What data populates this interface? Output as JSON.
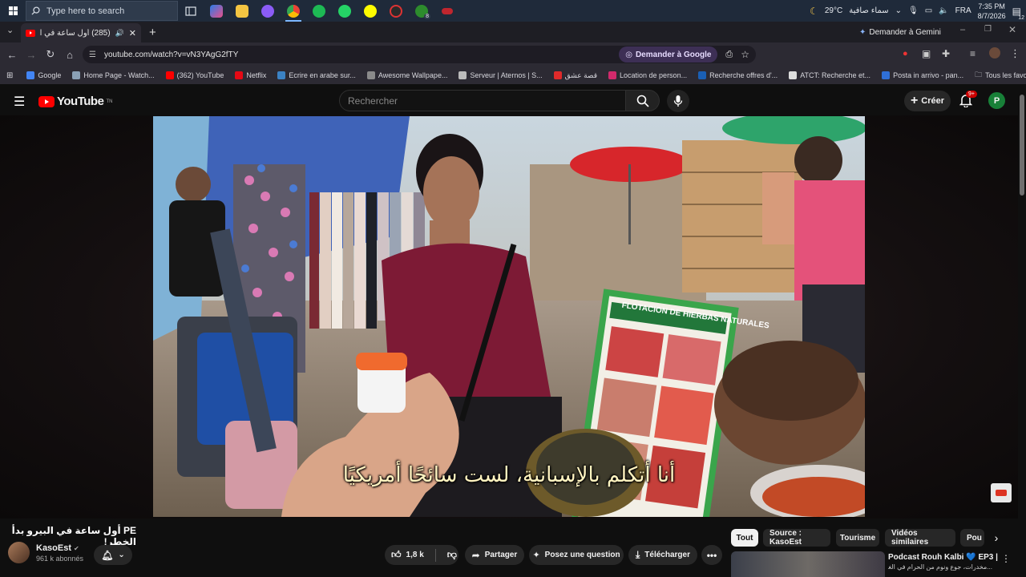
{
  "taskbar": {
    "search_placeholder": "Type here to search",
    "weather": "29°C",
    "weather_text": "سماء صافية",
    "language": "FRA",
    "time": "7:35 PM",
    "date": "8/7/2026",
    "notifications": "12",
    "xbox_badge": "8"
  },
  "browser": {
    "tab_title": "(285) أول ساعة في البيرو بدأ",
    "new_tab": "+",
    "gemini_tab_button": "Demander à Gemini",
    "url": "youtube.com/watch?v=vN3YAgG2fTY",
    "ask_google": "Demander à Google",
    "bookmarks": [
      {
        "label": "Google",
        "color": "#4285f4"
      },
      {
        "label": "Home Page - Watch...",
        "color": "#8aa0b5"
      },
      {
        "label": "(362) YouTube",
        "color": "#ff0000"
      },
      {
        "label": "Netflix",
        "color": "#e50914"
      },
      {
        "label": "Ecrire en arabe sur...",
        "color": "#3b82c4"
      },
      {
        "label": "Awesome Wallpape...",
        "color": "#8a8a8a"
      },
      {
        "label": "Serveur | Aternos | S...",
        "color": "#bbbbbb"
      },
      {
        "label": "قصة عشق",
        "color": "#e02a2a"
      },
      {
        "label": "Location de person...",
        "color": "#d12a6c"
      },
      {
        "label": "Recherche offres d'...",
        "color": "#1a5fb4"
      },
      {
        "label": "ATCT: Recherche et...",
        "color": "#dddddd"
      },
      {
        "label": "Posta in arrivo - pan...",
        "color": "#2f6fd6"
      }
    ],
    "all_bookmarks": "Tous les favoris"
  },
  "youtube": {
    "logo_text": "YouTube",
    "logo_region": "TN",
    "search_placeholder": "Rechercher",
    "create_label": "Créer",
    "notif_badge": "9+",
    "avatar_letter": "P",
    "subtitle": "أنا أتكلم بالإسبانية، لست سائحًا أمريكيًا",
    "video_title": "PE أول ساعة في البيرو بدأ الخطر!",
    "channel_name": "KasoEst",
    "subscribers": "961 k abonnés",
    "likes": "1,8 k",
    "share": "Partager",
    "ask": "Posez une question",
    "download": "Télécharger",
    "chips": [
      "Tout",
      "Source : KasoEst",
      "Tourisme",
      "Vidéos similaires",
      "Pou"
    ],
    "reco_title": "Podcast Rouh Kalbi 💙 EP3 |",
    "reco_subtitle": "...مخدرات، جوع ونوم من الحرام في الغربة"
  },
  "colors": {
    "yt_red": "#ff0000",
    "bg": "#0f0f0f",
    "chip_active": "#f1f1f1"
  }
}
